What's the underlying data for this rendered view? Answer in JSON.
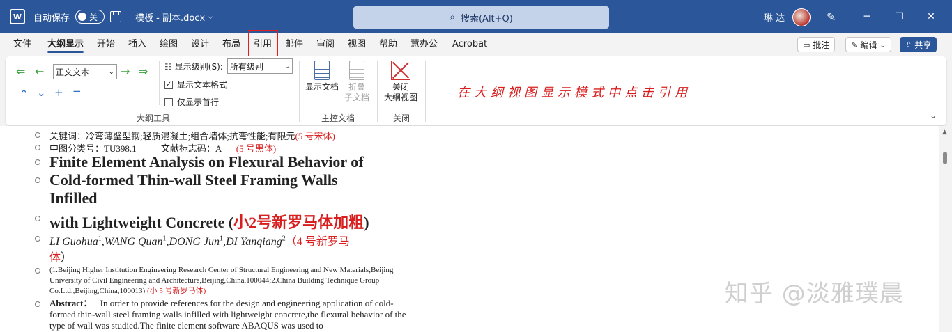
{
  "titlebar": {
    "app_icon": "W",
    "autosave_label": "自动保存",
    "autosave_state": "关",
    "doc_name": "模板 - 副本.docx",
    "search_placeholder": "搜索(Alt+Q)",
    "user_name": "琳 达",
    "minimize": "─",
    "maximize": "☐",
    "close": "✕"
  },
  "tabs": [
    "文件",
    "大纲显示",
    "开始",
    "插入",
    "绘图",
    "设计",
    "布局",
    "引用",
    "邮件",
    "审阅",
    "视图",
    "帮助",
    "慧办公",
    "Acrobat"
  ],
  "active_tab": "大纲显示",
  "highlighted_tab": "引用",
  "right_buttons": {
    "comment": "批注",
    "edit": "编辑",
    "share": "共享"
  },
  "ribbon": {
    "outline_tools": {
      "level_value": "正文文本",
      "show_level_label": "显示级别(S):",
      "show_level_value": "所有级别",
      "show_text_format": "显示文本格式",
      "show_text_format_checked": true,
      "first_line_only": "仅显示首行",
      "first_line_only_checked": false,
      "group_label": "大纲工具"
    },
    "master_doc": {
      "show_document": "显示文档",
      "collapse_line1": "折叠",
      "collapse_line2": "子文档",
      "group_label": "主控文档"
    },
    "close": {
      "close_line1": "关闭",
      "close_line2": "大纲视图",
      "group_label": "关闭"
    },
    "annotation": "在大纲视图显示模式中点击引用"
  },
  "document": {
    "keywords": "关键词：冷弯薄壁型钢;轻质混凝土;组合墙体;抗弯性能;有限元",
    "keywords_note": "(5 号宋体)",
    "classification": "中图分类号：TU398.1",
    "doc_code": "文献标志码：A",
    "classification_note": "(5 号黑体)",
    "title_line1": "Finite Element Analysis on Flexural Behavior of",
    "title_line2": "Cold-formed Thin-wall Steel Framing Walls",
    "title_line3": "Infilled",
    "title_line4": "with Lightweight Concrete (",
    "title_note": "小2号新罗马体加粗",
    "title_close": ")",
    "author1": "LI Guohua",
    "author2": ",WANG Quan",
    "author3": ",DONG Jun",
    "author4": ",DI Yanqiang",
    "sup1": "1",
    "sup2": "1",
    "sup3": "1",
    "sup4": "2",
    "authors_note": "（4 号新罗马",
    "authors_note2": "体",
    "authors_close": "）",
    "affiliation": "(1.Beijing Higher Institution Engineering Research Center of Structural Engineering and New Materials,Beijing University of Civil Engineering and Architecture,Beijing,China,100044;2.China Building Technique Group Co.Ltd.,Beijing,China,100013)",
    "affiliation_note": "(小 5 号新罗马体)",
    "abstract_label": "Abstract：",
    "abstract_text": "In order to provide references for the design and engineering application of cold-formed thin-wall steel framing walls infilled with lightweight concrete,the flexural behavior of the type of wall was studied.The finite element software ABAQUS was used to"
  },
  "watermark": "知乎 @淡雅璞晨",
  "colors": {
    "titlebar": "#2b579a",
    "annotation_red": "#d81e1e",
    "highlight_box": "#e02020"
  }
}
